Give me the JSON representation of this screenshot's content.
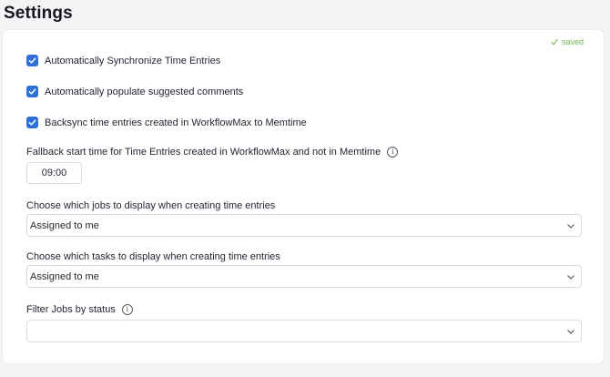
{
  "page": {
    "title": "Settings"
  },
  "status": {
    "saved_label": "saved"
  },
  "checkboxes": [
    {
      "label": "Automatically Synchronize Time Entries",
      "checked": true
    },
    {
      "label": "Automatically populate suggested comments",
      "checked": true
    },
    {
      "label": "Backsync time entries created in WorkflowMax to Memtime",
      "checked": true
    }
  ],
  "fallback": {
    "label": "Fallback start time for Time Entries created in WorkflowMax and not in Memtime",
    "value": "09:00",
    "info_icon": "info-icon"
  },
  "jobs_select": {
    "label": "Choose which jobs to display when creating time entries",
    "value": "Assigned to me"
  },
  "tasks_select": {
    "label": "Choose which tasks to display when creating time entries",
    "value": "Assigned to me"
  },
  "status_filter": {
    "label": "Filter Jobs by status",
    "value": "",
    "info_icon": "info-icon"
  },
  "colors": {
    "accent": "#2f6fd6",
    "saved": "#6bb84a",
    "background": "#f3f4f6"
  }
}
